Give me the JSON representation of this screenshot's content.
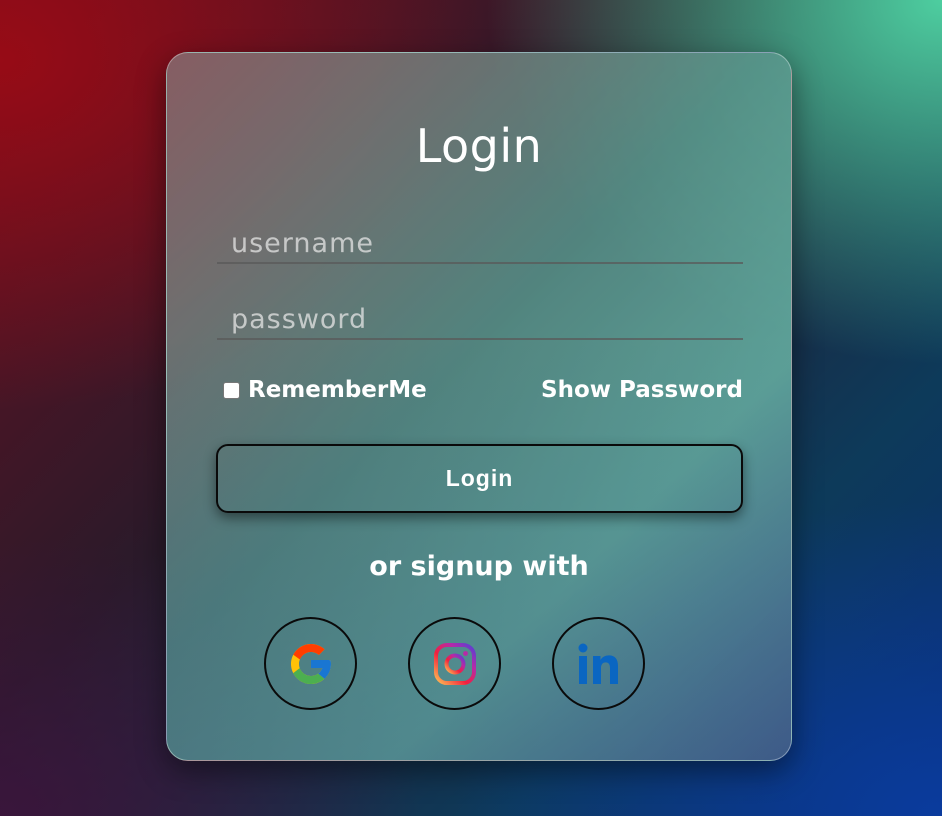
{
  "form": {
    "title": "Login",
    "username_placeholder": "username",
    "password_placeholder": "password",
    "remember_label": "RememberMe",
    "show_password_label": "Show Password",
    "login_button_label": "Login",
    "signup_text": "or signup with"
  },
  "social": [
    {
      "name": "google",
      "icon": "google-icon"
    },
    {
      "name": "instagram",
      "icon": "instagram-icon"
    },
    {
      "name": "linkedin",
      "icon": "linkedin-icon"
    }
  ],
  "colors": {
    "text": "#ffffff",
    "google_blue": "#4285F4",
    "google_red": "#EA4335",
    "google_yellow": "#FBBC05",
    "google_green": "#34A853",
    "linkedin_blue": "#0A66C2"
  }
}
